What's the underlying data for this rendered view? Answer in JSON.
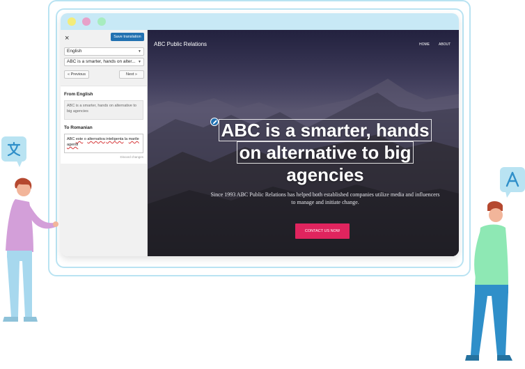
{
  "panel": {
    "close_label": "×",
    "save_label": "Save translation",
    "language_selected": "English",
    "string_selected": "ABC is a smarter, hands on alter...",
    "prev_label": "« Previous",
    "next_label": "Next »",
    "from_label": "From English",
    "from_text": "ABC is a smarter, hands on alternative to big agencies",
    "to_label": "To Romanian",
    "to_words": [
      "ABC",
      "este",
      "o",
      "alternativa",
      "inteligenta",
      "la",
      "marile",
      "agentii"
    ],
    "discard_label": "Discard changes"
  },
  "site": {
    "title": "ABC Public Relations",
    "nav": {
      "home": "HOME",
      "about": "ABOUT"
    },
    "headline_lines": [
      "ABC is a smarter, hands",
      "on alternative to big",
      "agencies"
    ],
    "subtext": "Since 1993 ABC Public Relations has helped both established companies utilize media and influencers to manage and initiate change.",
    "cta_label": "CONTACT US NOW"
  },
  "colors": {
    "accent": "#2271b1",
    "cta": "#e0245e",
    "frame": "#b9e3f2",
    "titlebar": "#c8e9f6"
  },
  "icons": [
    "close-icon",
    "caret-down-icon",
    "pencil-icon",
    "translate-icon",
    "letter-a-icon"
  ]
}
